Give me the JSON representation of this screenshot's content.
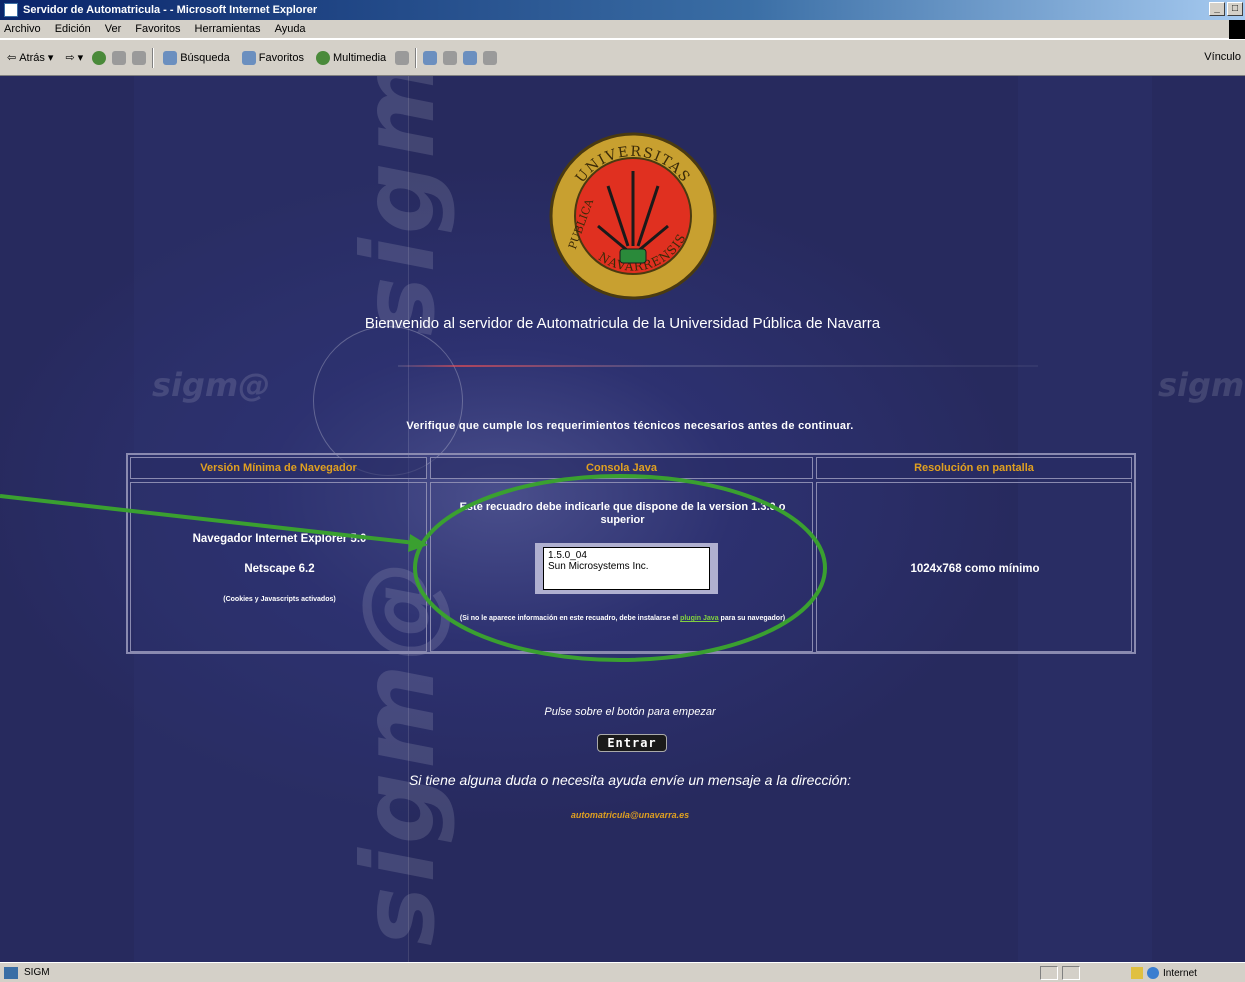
{
  "window": {
    "title": "Servidor de Automatricula - - Microsoft Internet Explorer",
    "minimize": "_",
    "maximize": "□"
  },
  "menu": [
    "Archivo",
    "Edición",
    "Ver",
    "Favoritos",
    "Herramientas",
    "Ayuda"
  ],
  "toolbar": {
    "back": "Atrás",
    "search": "Búsqueda",
    "favorites": "Favoritos",
    "multimedia": "Multimedia",
    "links": "Vínculo"
  },
  "page": {
    "watermark_text": "sigm@",
    "welcome": "Bienvenido al servidor de Automatricula de la Universidad Pública de Navarra",
    "verify": "Verifique que cumple los requerimientos técnicos necesarios antes de continuar.",
    "seal": {
      "top_text": "UNIVERSITAS",
      "left_text": "PUBLICA",
      "bottom_text": "NAVARRENSIS",
      "colors": {
        "ring": "#c8a030",
        "field": "#e03020",
        "border": "#4a3a10",
        "keys": "#1a1a1a",
        "base": "#2a8a3a"
      }
    },
    "table": {
      "headers": [
        "Versión Mínima de Navegador",
        "Consola Java",
        "Resolución en pantalla"
      ],
      "browser": {
        "ie": "Navegador Internet Explorer 5.0",
        "netscape": "Netscape 6.2",
        "note": "(Cookies y Javascripts activados)"
      },
      "java": {
        "desc": "Este recuadro debe indicarle que dispone de la version 1.3.0 o superior",
        "applet_version": "1.5.0_04",
        "applet_vendor": "Sun Microsystems Inc.",
        "note_pre": "(Si no le aparece información en este recuadro, debe instalarse el",
        "note_link": "plugin Java",
        "note_post": "para su navegador)"
      },
      "resolution": "1024x768 como mínimo"
    },
    "press_hint": "Pulse sobre el botón para empezar",
    "enter_label": "Entrar",
    "help_msg": "Si tiene alguna duda o necesita ayuda envíe un mensaje a la dirección:",
    "help_email": "automatricula@unavarra.es"
  },
  "status": {
    "text": "SIGM",
    "zone": "Internet"
  },
  "colors": {
    "background": "#2d3170",
    "header_text": "#e0a020",
    "annotation": "#3aa030",
    "link": "#80d040"
  }
}
